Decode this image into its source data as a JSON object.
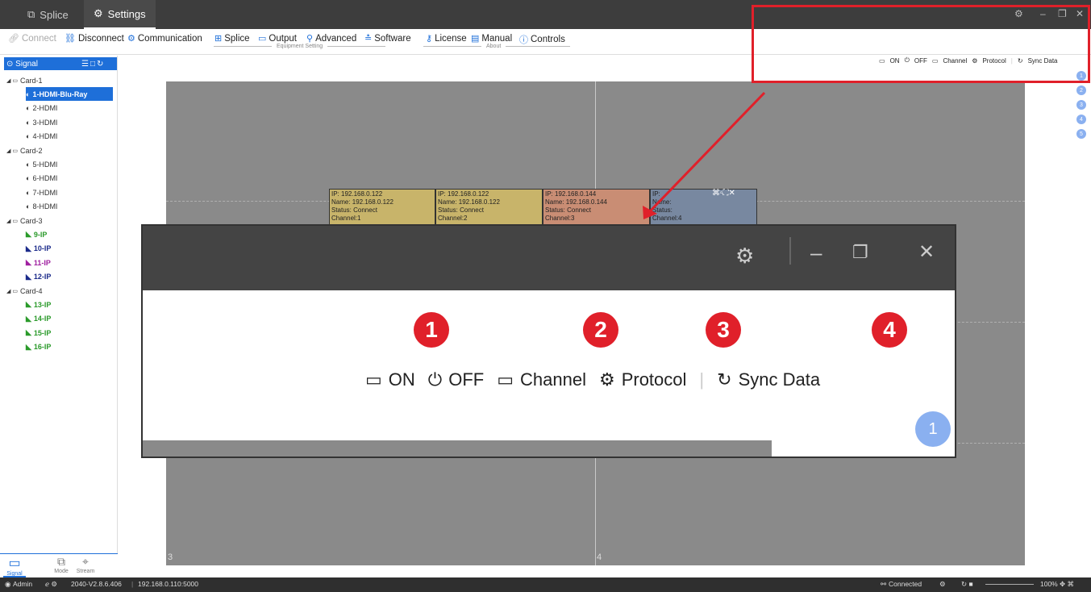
{
  "titlebar": {
    "tabs": [
      {
        "label": "Splice",
        "icon": "splice-icon"
      },
      {
        "label": "Settings",
        "icon": "gear-icon"
      }
    ]
  },
  "toolbar": {
    "items": [
      {
        "label": "Connect",
        "icon": "link-icon",
        "disabled": true
      },
      {
        "label": "Disconnect",
        "icon": "link-off-icon"
      },
      {
        "label": "Communication",
        "icon": "gear-icon"
      },
      {
        "label": "Splice",
        "icon": "grid-icon"
      },
      {
        "label": "Output",
        "icon": "monitor-icon"
      },
      {
        "label": "Advanced",
        "icon": "advanced-icon"
      },
      {
        "label": "Software",
        "icon": "sliders-icon"
      },
      {
        "label": "License",
        "icon": "key-icon"
      },
      {
        "label": "Manual",
        "icon": "document-icon"
      },
      {
        "label": "Controls",
        "icon": "info-icon"
      }
    ],
    "groups": [
      "Equipment Setting",
      "About"
    ]
  },
  "sidebar": {
    "header": "Signal",
    "tree": [
      {
        "label": "Card-1",
        "kind": "card"
      },
      {
        "label": "1-HDMI-Blu-Ray",
        "kind": "hdmi",
        "selected": true
      },
      {
        "label": "2-HDMI",
        "kind": "hdmi"
      },
      {
        "label": "3-HDMI",
        "kind": "hdmi"
      },
      {
        "label": "4-HDMI",
        "kind": "hdmi"
      },
      {
        "label": "Card-2",
        "kind": "card"
      },
      {
        "label": "5-HDMI",
        "kind": "hdmi"
      },
      {
        "label": "6-HDMI",
        "kind": "hdmi"
      },
      {
        "label": "7-HDMI",
        "kind": "hdmi"
      },
      {
        "label": "8-HDMI",
        "kind": "hdmi"
      },
      {
        "label": "Card-3",
        "kind": "card"
      },
      {
        "label": "9-IP",
        "kind": "ip",
        "color": "#2a9a2a"
      },
      {
        "label": "10-IP",
        "kind": "ip",
        "color": "#1a2a8a"
      },
      {
        "label": "11-IP",
        "kind": "ip",
        "color": "#a020a0"
      },
      {
        "label": "12-IP",
        "kind": "ip",
        "color": "#1a2a8a"
      },
      {
        "label": "Card-4",
        "kind": "card"
      },
      {
        "label": "13-IP",
        "kind": "ip",
        "color": "#2a9a2a"
      },
      {
        "label": "14-IP",
        "kind": "ip",
        "color": "#2a9a2a"
      },
      {
        "label": "15-IP",
        "kind": "ip",
        "color": "#2a9a2a"
      },
      {
        "label": "16-IP",
        "kind": "ip",
        "color": "#2a9a2a"
      }
    ],
    "bottom_tabs": [
      "Signal",
      "Mode",
      "Stream"
    ]
  },
  "wall": {
    "cell_labels": [
      "3",
      "4"
    ],
    "windows": [
      {
        "ip": "IP: 192.168.0.122",
        "name": "Name: 192.168.0.122",
        "status": "Status: Connect",
        "channel": "Channel:1",
        "color": "#c8b46a"
      },
      {
        "ip": "IP: 192.168.0.122",
        "name": "Name: 192.168.0.122",
        "status": "Status: Connect",
        "channel": "Channel:2",
        "color": "#c8b46a"
      },
      {
        "ip": "IP: 192.168.0.144",
        "name": "Name: 192.168.0.144",
        "status": "Status: Connect",
        "channel": "Channel:3",
        "color": "#c98d74"
      },
      {
        "ip": "IP:",
        "name": "Name:",
        "status": "Status:",
        "channel": "Channel:4",
        "color": "#7888a0"
      }
    ]
  },
  "right_toolbar": {
    "items": [
      "ON",
      "OFF",
      "Channel",
      "Protocol",
      "Sync Data"
    ],
    "dots": [
      "1",
      "2",
      "3",
      "4",
      "5"
    ]
  },
  "zoom": {
    "numbers": [
      "1",
      "2",
      "3",
      "4"
    ],
    "items": [
      "ON",
      "OFF",
      "Channel",
      "Protocol",
      "Sync Data"
    ],
    "dot": "1"
  },
  "statusbar": {
    "user": "Admin",
    "version": "2040-V2.8.6.406",
    "address": "192.168.0.110:5000",
    "connection": "Connected",
    "zoom": "100%"
  },
  "colors": {
    "accent": "#1e6fd9",
    "annotation": "#e0202a"
  }
}
